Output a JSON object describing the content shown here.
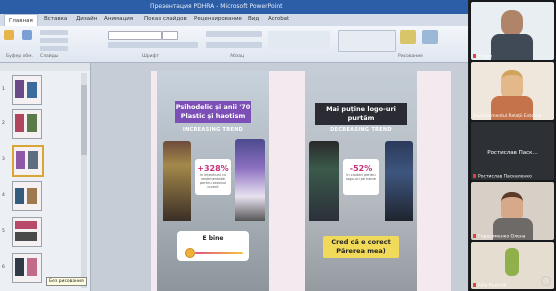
{
  "window": {
    "title": "Презентация PDHRA - Microsoft PowerPoint"
  },
  "ribbon": {
    "tabs": [
      "Главная",
      "Вставка",
      "Дизайн",
      "Анимация",
      "Показ слайдов",
      "Рецензирование",
      "Вид",
      "Acrobat"
    ],
    "groups": [
      "Буфер обм.",
      "Слайды",
      "Шрифт",
      "Абзац",
      "Рисование"
    ]
  },
  "slides_panel": {
    "tooltip": "Без рисования"
  },
  "slide": {
    "left_story": {
      "headline_line1": "Psihodelic și anii '70",
      "headline_line2": "Plastic și haotism",
      "trend_label": "INCREASING TREND",
      "stat_value": "+328%",
      "stat_caption": "in intentiuni cu vestimentatie pentru sezonul curent",
      "poll_question": "E bine"
    },
    "right_story": {
      "headline": "Mai puține logo-uri purtăm",
      "trend_label": "DECREASING TREND",
      "stat_value": "-52%",
      "stat_caption": "in cautari pentru logo-uri pe haine",
      "answer_line1": "Cred că e corect",
      "answer_line2": "Părerea mea)"
    }
  },
  "participants": [
    {
      "name": "Eugen",
      "role": "speaker"
    },
    {
      "name": "Departamentul Relații Externe",
      "role": "participant"
    },
    {
      "name": "Ростислав Паскаленко",
      "label": "Ростислав Паск..."
    },
    {
      "name": "Герасименко Олена",
      "role": "participant"
    },
    {
      "name": "Iulia Radulsk",
      "role": "participant"
    }
  ],
  "colors": {
    "ribbon_blue": "#2c5ea8",
    "headline_purple": "#7c4fb6",
    "stat_pink": "#c8327b",
    "answer_yellow": "#f1d95a",
    "thumb_selected": "#d9a636"
  }
}
